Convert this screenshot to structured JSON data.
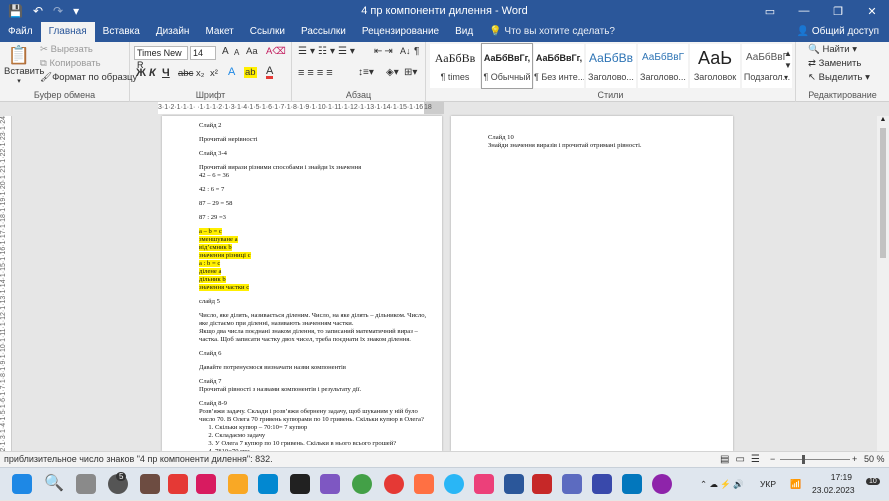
{
  "window": {
    "title": "4 пр компоненти дилення - Word",
    "min_icon": "minimize-icon",
    "restore_icon": "restore-icon",
    "close_icon": "close-icon"
  },
  "quick_access": {
    "save_icon": "save-icon",
    "undo_icon": "undo-icon",
    "redo_icon": "redo-icon"
  },
  "tabs": [
    "Файл",
    "Главная",
    "Вставка",
    "Дизайн",
    "Макет",
    "Ссылки",
    "Рассылки",
    "Рецензирование",
    "Вид"
  ],
  "active_tab": "Главная",
  "tell_me": "Что вы хотите сделать?",
  "share": "Общий доступ",
  "clipboard": {
    "paste": "Вставить",
    "cut": "Вырезать",
    "copy": "Копировать",
    "format_painter": "Формат по образцу",
    "label": "Буфер обмена"
  },
  "font": {
    "name": "Times New R",
    "size": "14",
    "grow": "A",
    "shrink": "A",
    "case": "Aa",
    "bold": "Ж",
    "italic": "К",
    "underline": "Ч",
    "strike": "abc",
    "sub": "x₂",
    "sup": "x²",
    "effects": "A",
    "highlight": "ab",
    "color": "A",
    "label": "Шрифт"
  },
  "paragraph": {
    "label": "Абзац",
    "pilcrow": "¶"
  },
  "styles": {
    "items": [
      {
        "preview": "АаБбВв",
        "name": "¶ times"
      },
      {
        "preview": "АаБбВвГг,",
        "name": "¶ Обычный"
      },
      {
        "preview": "АаБбВвГг,",
        "name": "¶ Без инте..."
      },
      {
        "preview": "АаБбВв",
        "name": "Заголово..."
      },
      {
        "preview": "АаБбВвГ",
        "name": "Заголово..."
      },
      {
        "preview": "АаЬ",
        "name": "Заголовок"
      },
      {
        "preview": "АаБбВвГ",
        "name": "Подзагол..."
      }
    ],
    "label": "Стили"
  },
  "editing": {
    "find": "Найти",
    "replace": "Заменить",
    "select": "Выделить",
    "label": "Редактирование"
  },
  "ruler": "3·1·2·1·1·1·  ·1·1·1·2·1·3·1·4·1·5·1·6·1·7·1·8·1·9·1·10·1·11·1·12·1·13·1·14·1·15·1·16·1·",
  "ruler_right": "18",
  "vruler": "·1·2·1·1·1· ·1·1·1·2·1·3·1·4·1·5·1·6·1·7·1·8·1·9·1·10·1·11·1·12·1·13·1·14·1·15·1·16·1·17·1·18·1·19·1·20·1·21·1·22·1·23·1·24",
  "page1": {
    "lines": [
      {
        "t": "Слайд 2"
      },
      {
        "t": "Прочитай нерівності"
      },
      {
        "t": "Слайд 3-4"
      },
      {
        "t": "Прочитай вирази різними способами і знайди їх значення"
      },
      {
        "t": "42 – 6  = 36"
      },
      {
        "t": "42 : 6 = 7"
      },
      {
        "t": "87 – 29 = 58"
      },
      {
        "t": "87 : 29 =3"
      },
      {
        "t": "а – b = с",
        "hl": true
      },
      {
        "t": "зменшуване а",
        "hl": true
      },
      {
        "t": "від’ємник b",
        "hl": true
      },
      {
        "t": "значення різниці с",
        "hl": true
      },
      {
        "t": "а : b = с",
        "hl": true
      },
      {
        "t": "ділене а",
        "hl": true
      },
      {
        "t": "дільник b",
        "hl": true
      },
      {
        "t": "значення частки с",
        "hl": true
      },
      {
        "t": "слайд 5"
      },
      {
        "t": "Число, яке ділять, називається діленим. Число, на яке ділять – дільником. Число,"
      },
      {
        "t": "яке дістаємо при діленні, називають значенням частки."
      },
      {
        "t": "Якщо два числа поєднані знаком ділення, то записаний математичний вираз –"
      },
      {
        "t": "частка. Щоб записати частку двох чисел, треба поєднати їх знаком ділення."
      },
      {
        "t": "Слайд 6"
      },
      {
        "t": "Давайте потренуємося визначати назви компонентів"
      },
      {
        "t": "Слайд 7"
      },
      {
        "t": "Прочитай рівності з назвами компонентів і результату дії."
      },
      {
        "t": "Слайд 8-9"
      },
      {
        "t": "Розв’яжи задачу. Склади і розв’яжи обернену задачу, щоб шуканим у ній було"
      },
      {
        "t": "число 70. В Олега 70 гривень купюрами по 10 гривень. Скільки купюр в Олега?"
      }
    ],
    "list": [
      "Скільки купюр – 70:10= 7 купюр",
      "Складаємо задачу",
      "У Олега 7 купюр по 10 гривень. Скільки в нього всього грошей?",
      "7*10=70 грн"
    ]
  },
  "page2": {
    "lines": [
      {
        "t": "Слайд 10"
      },
      {
        "t": "Знайди значення виразів і прочитай отримані рівності."
      }
    ]
  },
  "status": {
    "words": "приблизительное число знаков \"4 пр компоненти дилення\": 832.",
    "zoom": "50 %"
  },
  "taskbar": {
    "lang": "УКР",
    "time": "17:19",
    "date": "23.02.2023",
    "notif": "10",
    "badge": "5"
  }
}
